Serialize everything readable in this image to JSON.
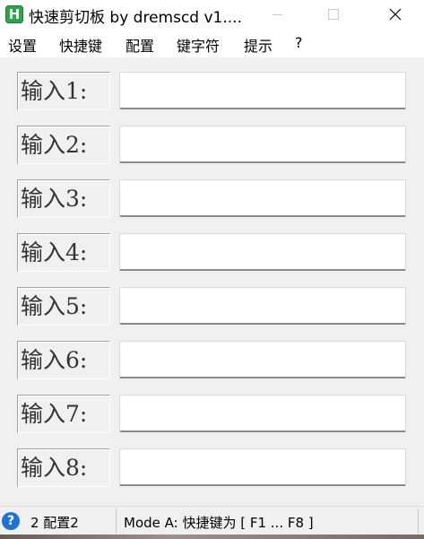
{
  "window": {
    "title": "快速剪切板 by dremscd v1....",
    "app_icon_letter": "H",
    "app_icon_color": "#2ea44f"
  },
  "menu": {
    "items": [
      "设置",
      "快捷键",
      "配置",
      "键字符",
      "提示",
      "?"
    ]
  },
  "inputs": {
    "rows": [
      {
        "label": "输入1:",
        "value": ""
      },
      {
        "label": "输入2:",
        "value": ""
      },
      {
        "label": "输入3:",
        "value": ""
      },
      {
        "label": "输入4:",
        "value": ""
      },
      {
        "label": "输入5:",
        "value": ""
      },
      {
        "label": "输入6:",
        "value": ""
      },
      {
        "label": "输入7:",
        "value": ""
      },
      {
        "label": "输入8:",
        "value": ""
      }
    ]
  },
  "status": {
    "help_icon": "question-icon",
    "left_text": "2 配置2",
    "right_text": "Mode A: 快捷键为 [ F1 ... F8 ]"
  }
}
